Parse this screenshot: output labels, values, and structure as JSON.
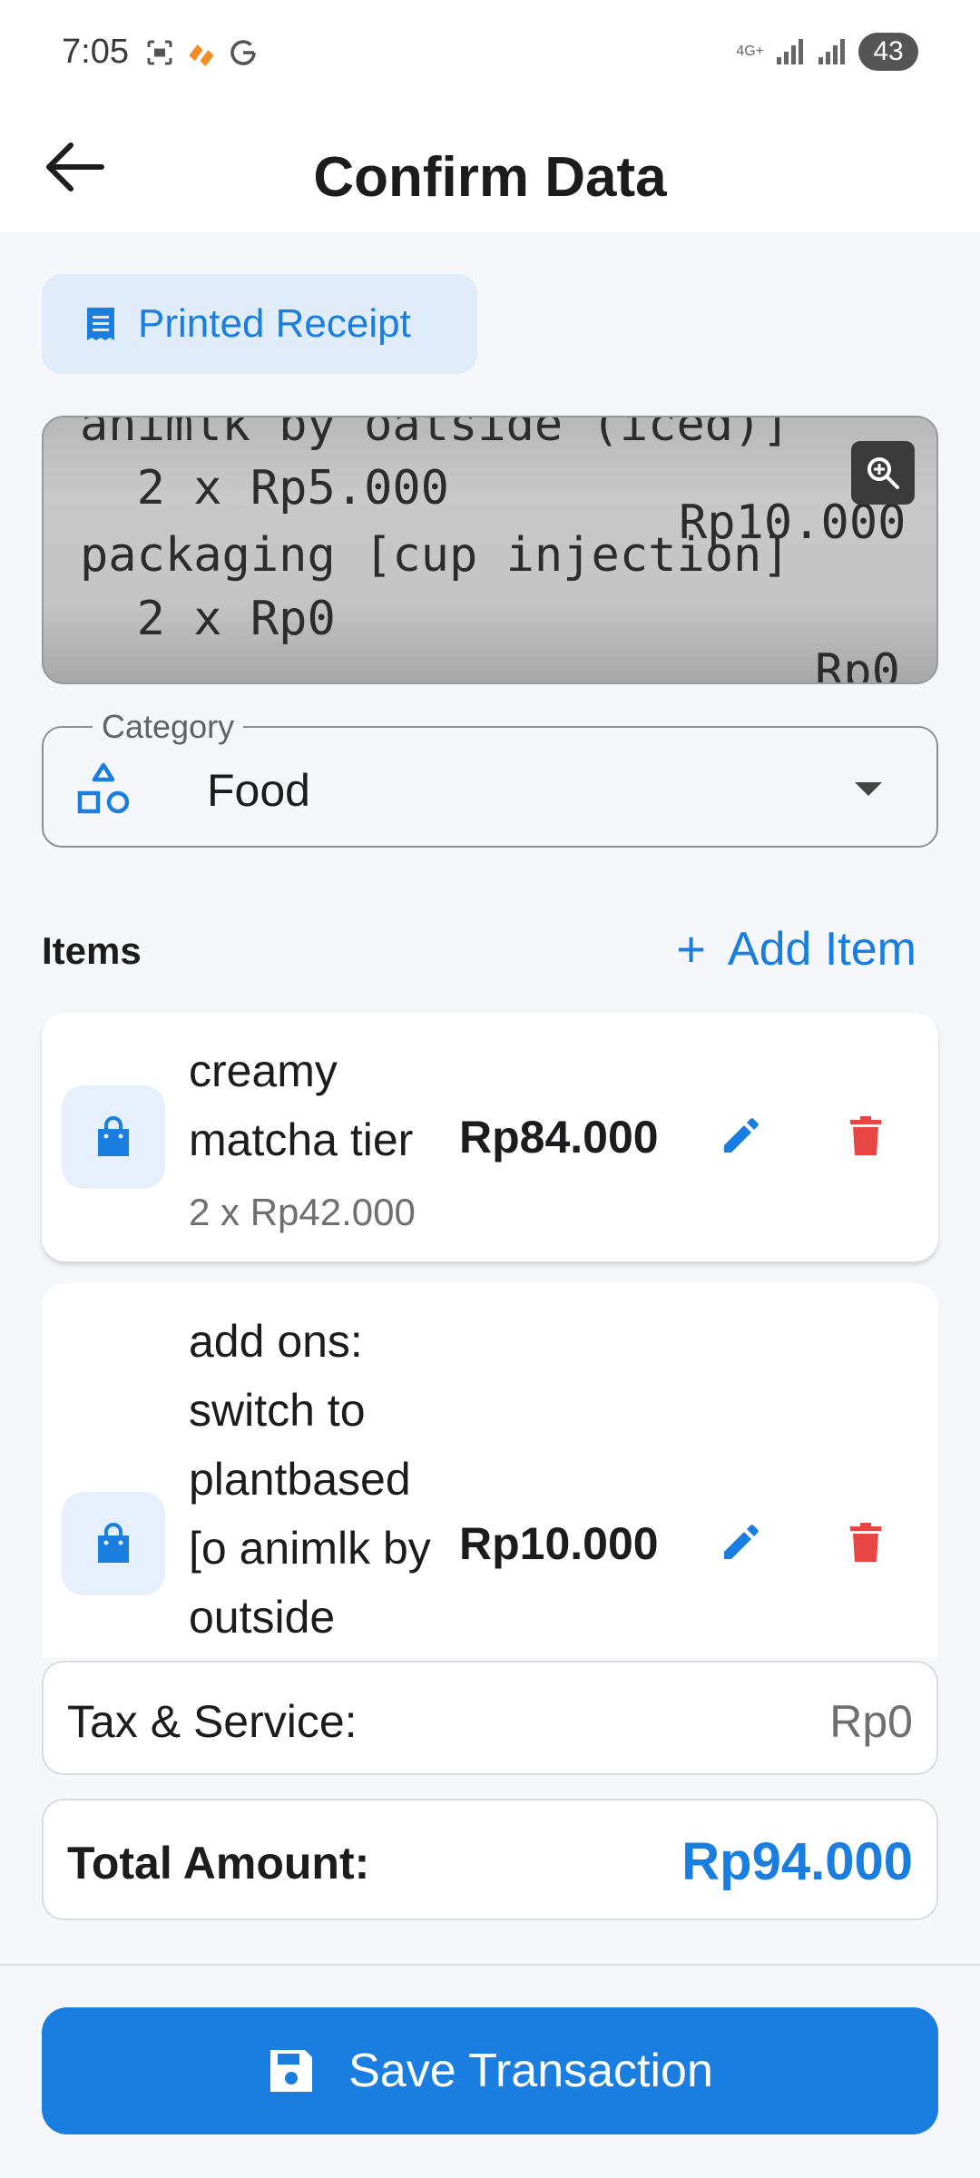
{
  "status_bar": {
    "time": "7:05",
    "network": "4G+",
    "battery": "43"
  },
  "header": {
    "title": "Confirm Data"
  },
  "receipt_badge": {
    "label": "Printed Receipt"
  },
  "receipt_image": {
    "lines": [
      "animlk by oatside (iced)]",
      "  2 x Rp5.000",
      "packaging [cup injection]",
      "  2 x Rp0",
      "Rp10.000",
      "Rp0"
    ]
  },
  "category": {
    "label": "Category",
    "value": "Food"
  },
  "items_section": {
    "heading": "Items",
    "add_label": "Add Item"
  },
  "items": [
    {
      "name_lines": [
        "creamy",
        "matcha tier"
      ],
      "subtitle": "2 x Rp42.000",
      "price": "Rp84.000"
    },
    {
      "name_lines": [
        "add ons:",
        "switch to",
        "plantbased",
        "[o animlk by",
        "outside"
      ],
      "price": "Rp10.000"
    }
  ],
  "tax": {
    "label": "Tax & Service:",
    "value": "Rp0"
  },
  "total": {
    "label": "Total Amount:",
    "value": "Rp94.000"
  },
  "save": {
    "label": "Save Transaction"
  },
  "colors": {
    "accent": "#1a7de0",
    "danger": "#e84545",
    "badge_bg": "#e1ecfa"
  }
}
